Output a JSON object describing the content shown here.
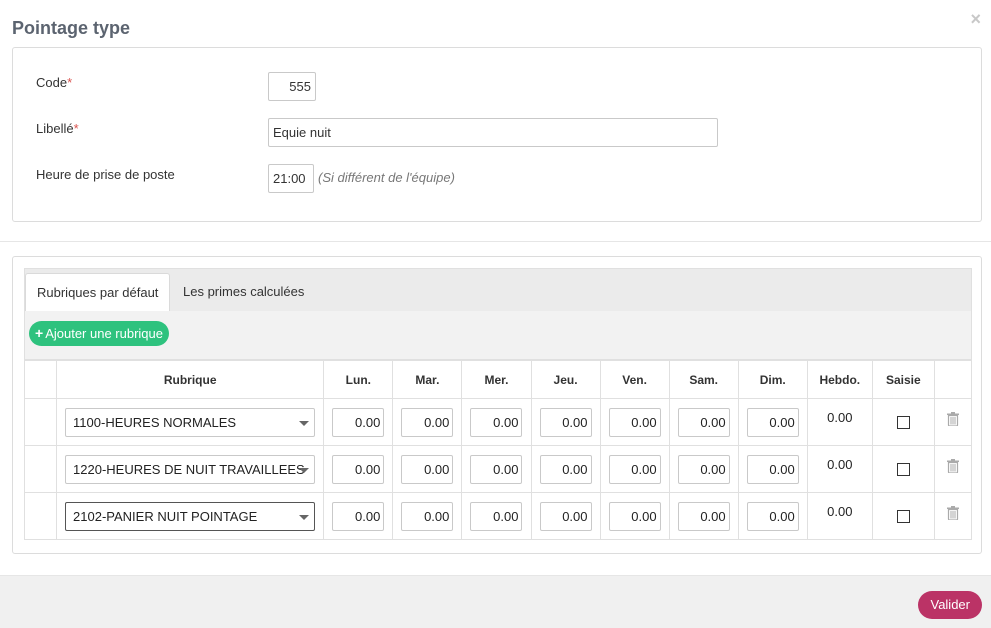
{
  "modal": {
    "title": "Pointage type",
    "close_icon": "×"
  },
  "form": {
    "code_label": "Code",
    "code_value": "555",
    "libelle_label": "Libellé",
    "libelle_value": "Equie nuit",
    "heure_label": "Heure de prise de poste",
    "heure_value": "21:00",
    "heure_hint": "(Si différent de l'équipe)",
    "required_mark": "*"
  },
  "tabs": [
    {
      "label": "Rubriques par défaut",
      "active": true
    },
    {
      "label": "Les primes calculées",
      "active": false
    }
  ],
  "toolbar": {
    "add_label": "Ajouter une rubrique",
    "add_icon": "+"
  },
  "table": {
    "headers": {
      "rubrique": "Rubrique",
      "lun": "Lun.",
      "mar": "Mar.",
      "mer": "Mer.",
      "jeu": "Jeu.",
      "ven": "Ven.",
      "sam": "Sam.",
      "dim": "Dim.",
      "hebdo": "Hebdo.",
      "saisie": "Saisie"
    },
    "rows": [
      {
        "rubrique": "1100-HEURES NORMALES",
        "days": [
          "0.00",
          "0.00",
          "0.00",
          "0.00",
          "0.00",
          "0.00",
          "0.00"
        ],
        "hebdo": "0.00",
        "saisie": false
      },
      {
        "rubrique": "1220-HEURES DE NUIT TRAVAILLEES",
        "days": [
          "0.00",
          "0.00",
          "0.00",
          "0.00",
          "0.00",
          "0.00",
          "0.00"
        ],
        "hebdo": "0.00",
        "saisie": false
      },
      {
        "rubrique": "2102-PANIER NUIT POINTAGE",
        "days": [
          "0.00",
          "0.00",
          "0.00",
          "0.00",
          "0.00",
          "0.00",
          "0.00"
        ],
        "hebdo": "0.00",
        "saisie": false
      }
    ]
  },
  "footer": {
    "valider_label": "Valider"
  },
  "colors": {
    "add_button": "#2ec27e",
    "valider_button": "#bb3366",
    "required": "#d9534f"
  }
}
